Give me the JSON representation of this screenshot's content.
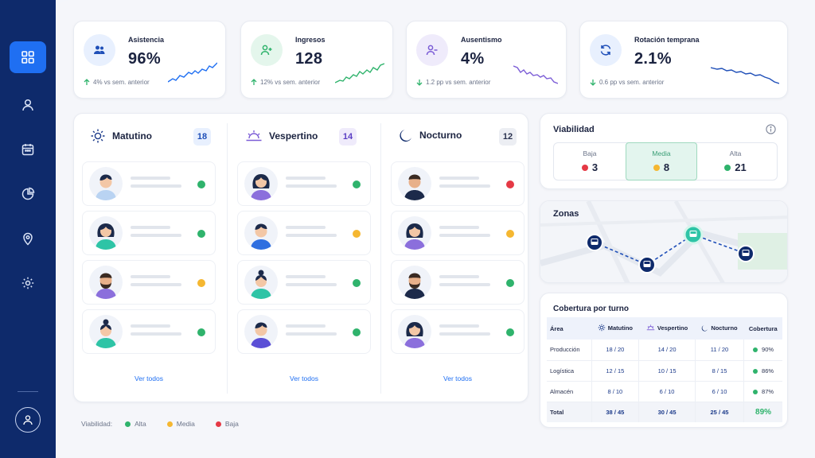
{
  "sidebar": {
    "items": [
      {
        "icon": "grid-icon",
        "active": true
      },
      {
        "icon": "user-icon",
        "active": false
      },
      {
        "icon": "calendar-icon",
        "active": false
      },
      {
        "icon": "pie-chart-icon",
        "active": false
      },
      {
        "icon": "map-pin-icon",
        "active": false
      },
      {
        "icon": "gear-icon",
        "active": false
      }
    ],
    "profile_icon": "user-circle-icon"
  },
  "kpis": [
    {
      "title": "Asistencia",
      "value": "96%",
      "delta": "4% vs sem. anterior",
      "trend": "up",
      "icon": "users-icon",
      "color": "#1f6ff2"
    },
    {
      "title": "Ingresos",
      "value": "128",
      "delta": "12% vs sem. anterior",
      "trend": "up",
      "icon": "user-plus-icon",
      "color": "#2fb36c"
    },
    {
      "title": "Ausentismo",
      "value": "4%",
      "delta": "1.2 pp vs sem. anterior",
      "trend": "down",
      "icon": "user-minus-icon",
      "color": "#7b5cd6"
    },
    {
      "title": "Rotación temprana",
      "value": "2.1%",
      "delta": "0.6 pp vs sem. anterior",
      "trend": "down",
      "icon": "refresh-icon",
      "color": "#1f6ff2"
    }
  ],
  "shifts": [
    {
      "name": "Matutino",
      "count": "18",
      "icon": "sun-icon",
      "see_all": "Ver todos",
      "employees": [
        {
          "status": "alta"
        },
        {
          "status": "alta"
        },
        {
          "status": "media"
        },
        {
          "status": "alta"
        }
      ]
    },
    {
      "name": "Vespertino",
      "count": "14",
      "icon": "sunset-icon",
      "see_all": "Ver todos",
      "employees": [
        {
          "status": "alta"
        },
        {
          "status": "media"
        },
        {
          "status": "alta"
        },
        {
          "status": "alta"
        }
      ]
    },
    {
      "name": "Nocturno",
      "count": "12",
      "icon": "moon-icon",
      "see_all": "Ver todos",
      "employees": [
        {
          "status": "baja"
        },
        {
          "status": "media"
        },
        {
          "status": "alta"
        },
        {
          "status": "alta"
        }
      ]
    }
  ],
  "legend": {
    "label": "Viabilidad:",
    "items": [
      {
        "label": "Alta",
        "color": "#2fb36c"
      },
      {
        "label": "Media",
        "color": "#f5b731"
      },
      {
        "label": "Baja",
        "color": "#e53945"
      }
    ]
  },
  "viabilidad": {
    "title": "Viabilidad",
    "info_icon": "info-icon",
    "levels": [
      {
        "label": "Baja",
        "value": "3",
        "color": "#e53945"
      },
      {
        "label": "Media",
        "value": "8",
        "color": "#f5b731",
        "selected": true
      },
      {
        "label": "Alta",
        "value": "21",
        "color": "#2fb36c"
      }
    ]
  },
  "zonas": {
    "title": "Zonas",
    "stop_icon": "bus-icon"
  },
  "coverage": {
    "title": "Cobertura por turno",
    "headers": [
      "Área",
      "Matutino",
      "Vespertino",
      "Nocturno",
      "Cobertura"
    ],
    "rows": [
      {
        "area": "Producción",
        "mat": "18 / 20",
        "ves": "14 / 20",
        "noc": "11 / 20",
        "cov": "90%"
      },
      {
        "area": "Logística",
        "mat": "12 / 15",
        "ves": "10 / 15",
        "noc": "8 / 15",
        "cov": "86%"
      },
      {
        "area": "Almacén",
        "mat": "8 / 10",
        "ves": "6 / 10",
        "noc": "6 / 10",
        "cov": "87%"
      }
    ],
    "total": {
      "area": "Total",
      "mat": "38 / 45",
      "ves": "30 / 45",
      "noc": "25 / 45",
      "cov": "89%"
    }
  },
  "colors": {
    "accent": "#1f6ff2",
    "sidebar": "#0e2a6b",
    "alta": "#2fb36c",
    "media": "#f5b731",
    "baja": "#e53945"
  }
}
